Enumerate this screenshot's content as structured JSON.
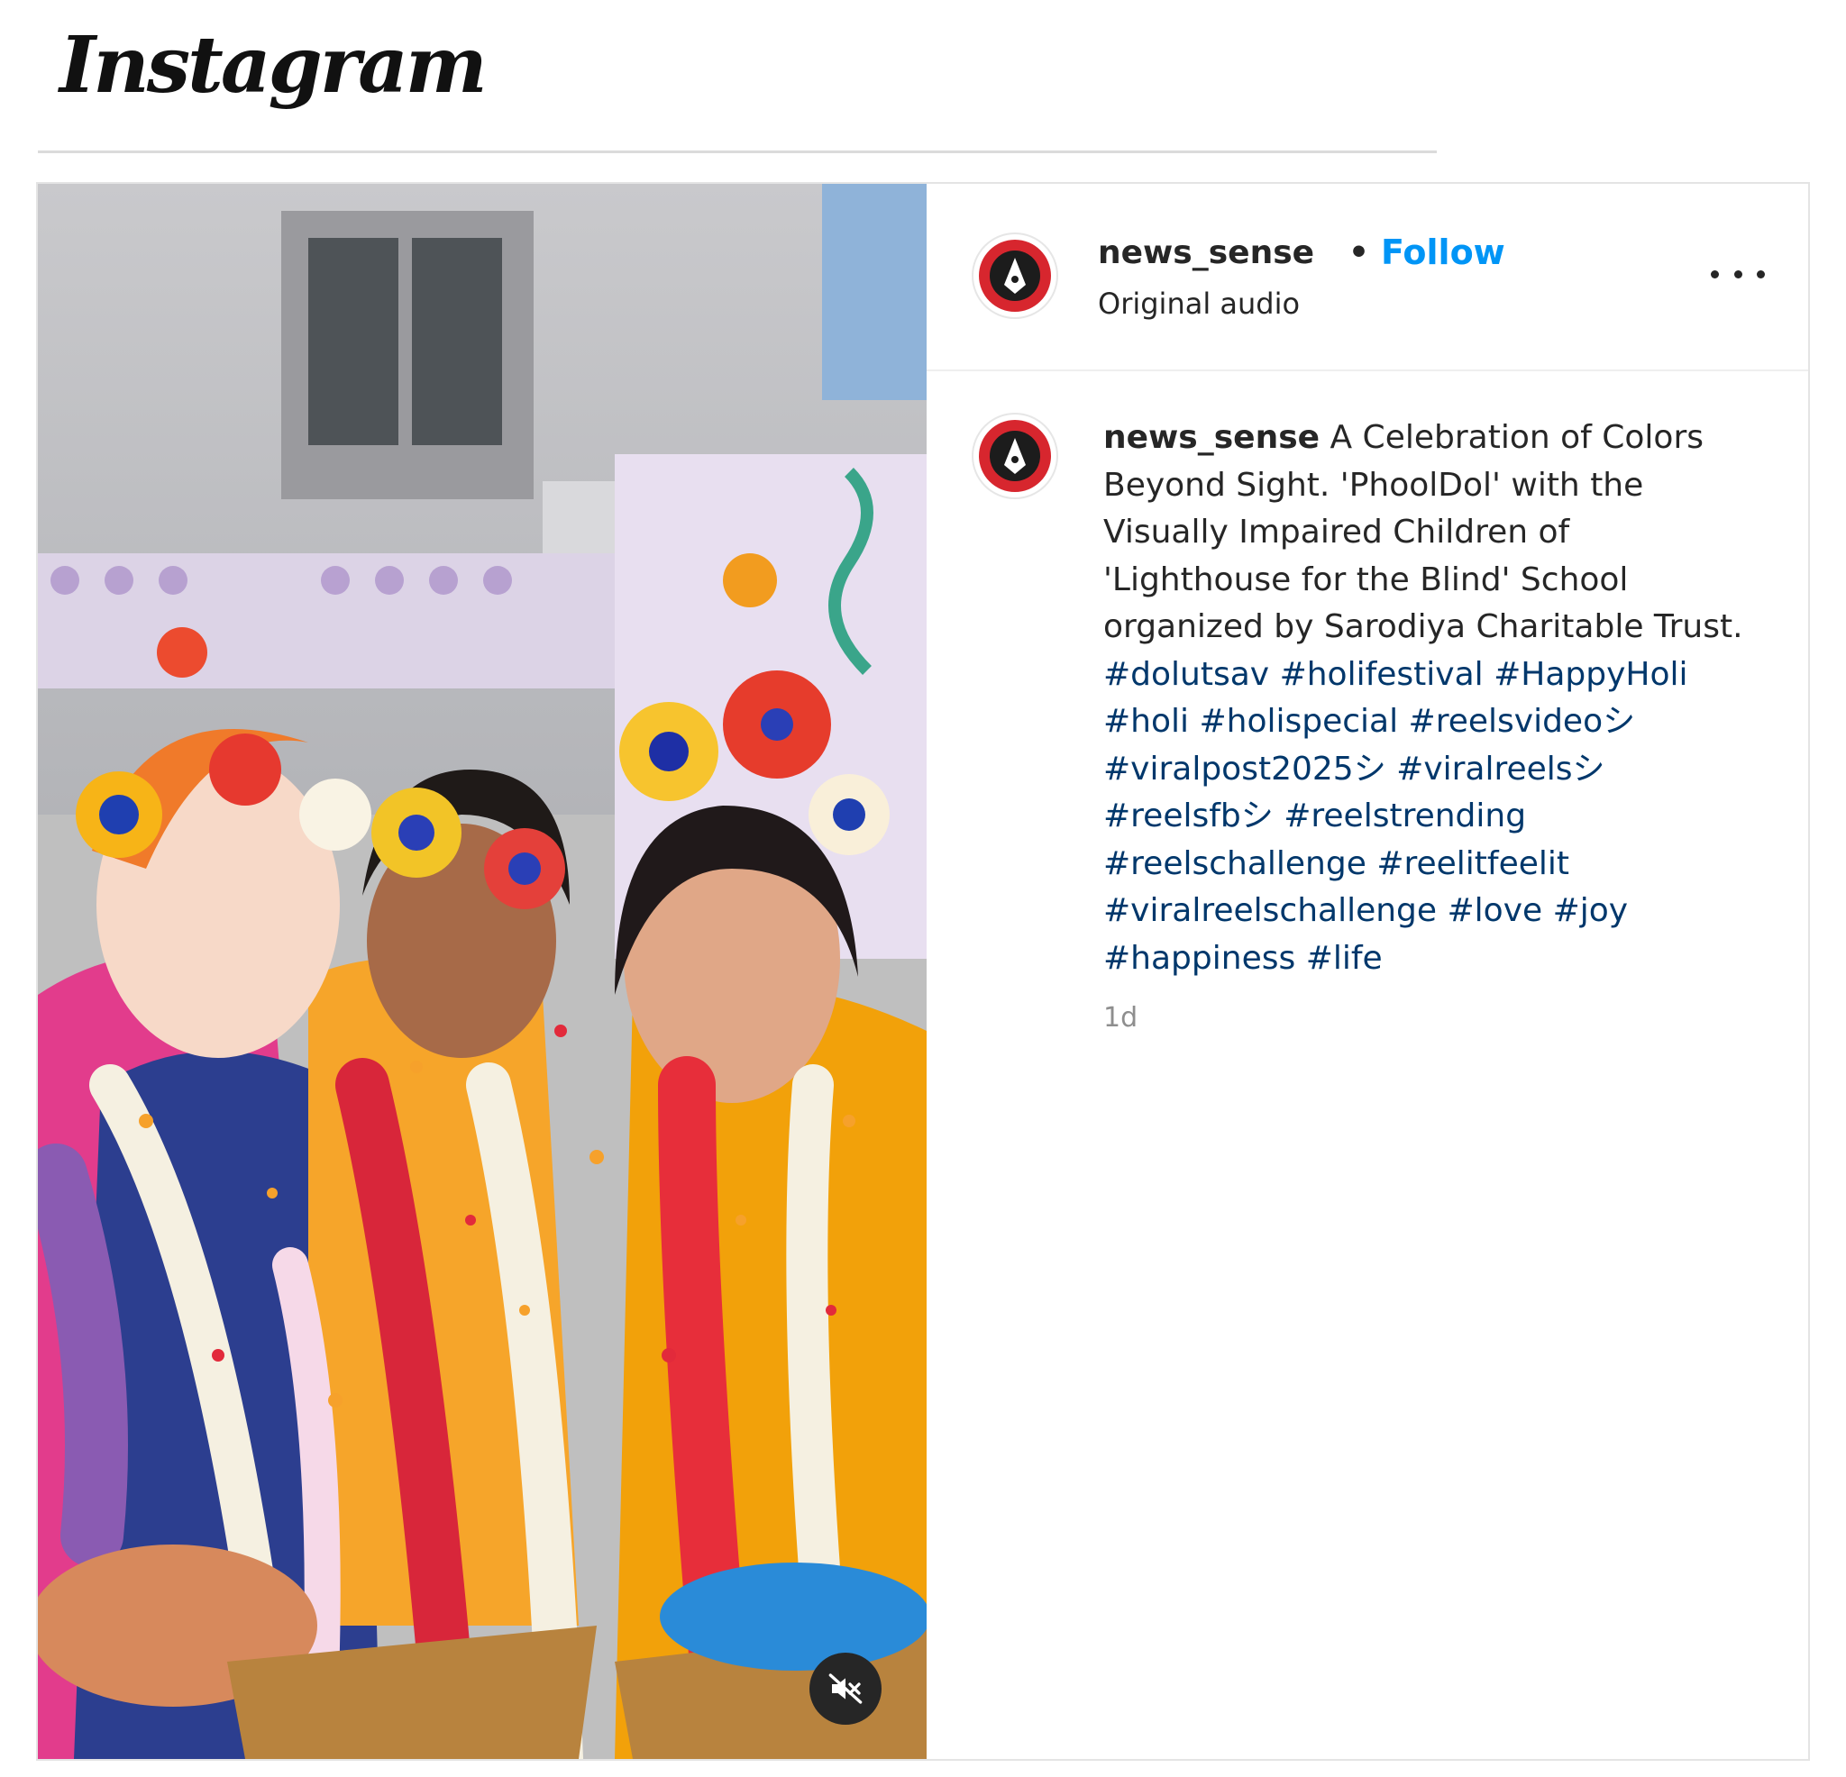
{
  "header": {
    "logo_text": "Instagram"
  },
  "post": {
    "author": {
      "username": "news_sense",
      "separator": "•",
      "follow_label": "Follow",
      "audio_label": "Original audio",
      "more_icon": "more-horizontal-icon"
    },
    "media": {
      "mute_icon": "speaker-muted-icon"
    },
    "caption": {
      "username": "news_sense",
      "text": " A Celebration of Colors Beyond Sight. 'PhoolDol' with the Visually Impaired Children of 'Lighthouse for the Blind' School organized by Sarodiya Charitable Trust. ",
      "hashtags": [
        "#dolutsav",
        "#holifestival",
        "#HappyHoli",
        "#holi",
        "#holispecial",
        "#reelsvideoシ",
        "#viralpost2025シ",
        "#viralreelsシ",
        "#reelsfbシ",
        "#reelstrending",
        "#reelschallenge",
        "#reelitfeelit",
        "#viralreelschallenge",
        "#love",
        "#joy",
        "#happiness",
        "#life"
      ]
    },
    "timestamp": "1d"
  },
  "colors": {
    "follow": "#0095f6",
    "hashtag": "#00376b",
    "timestamp": "#8e8e8e",
    "avatar_red": "#d7262e"
  }
}
